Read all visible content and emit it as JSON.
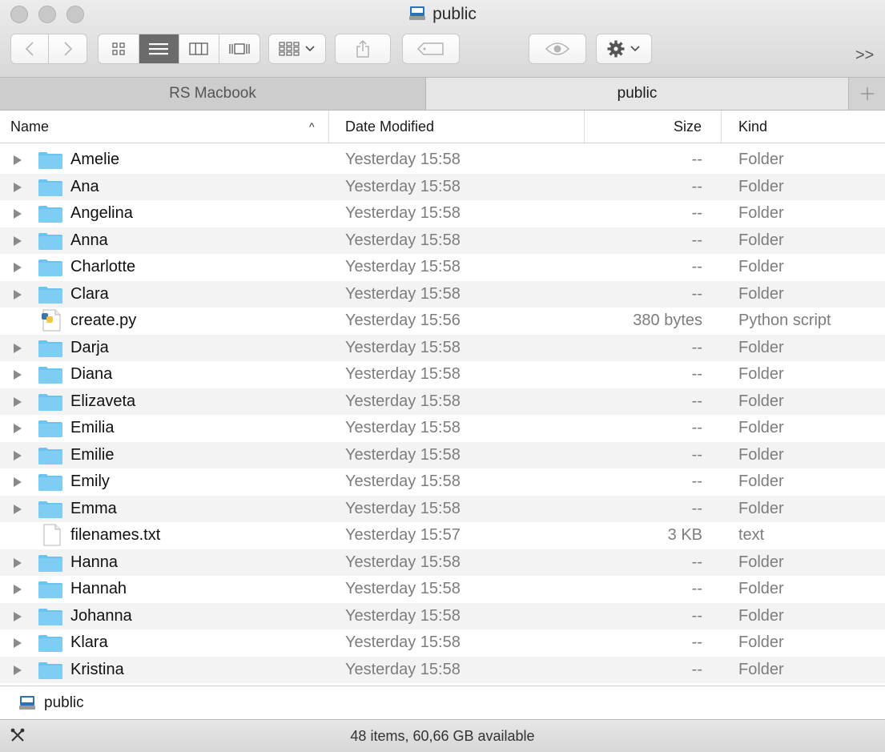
{
  "window": {
    "title": "public"
  },
  "toolbar": {
    "overflow_label": ">>"
  },
  "tabs": [
    {
      "label": "RS Macbook",
      "active": false
    },
    {
      "label": "public",
      "active": true
    }
  ],
  "columns": {
    "name": "Name",
    "date": "Date Modified",
    "size": "Size",
    "kind": "Kind",
    "sort_indicator": "^"
  },
  "rows": [
    {
      "name": "Amelie",
      "date": "Yesterday 15:58",
      "size": "--",
      "kind": "Folder",
      "type": "folder"
    },
    {
      "name": "Ana",
      "date": "Yesterday 15:58",
      "size": "--",
      "kind": "Folder",
      "type": "folder"
    },
    {
      "name": "Angelina",
      "date": "Yesterday 15:58",
      "size": "--",
      "kind": "Folder",
      "type": "folder"
    },
    {
      "name": "Anna",
      "date": "Yesterday 15:58",
      "size": "--",
      "kind": "Folder",
      "type": "folder"
    },
    {
      "name": "Charlotte",
      "date": "Yesterday 15:58",
      "size": "--",
      "kind": "Folder",
      "type": "folder"
    },
    {
      "name": "Clara",
      "date": "Yesterday 15:58",
      "size": "--",
      "kind": "Folder",
      "type": "folder"
    },
    {
      "name": "create.py",
      "date": "Yesterday 15:56",
      "size": "380 bytes",
      "kind": "Python script",
      "type": "python"
    },
    {
      "name": "Darja",
      "date": "Yesterday 15:58",
      "size": "--",
      "kind": "Folder",
      "type": "folder"
    },
    {
      "name": "Diana",
      "date": "Yesterday 15:58",
      "size": "--",
      "kind": "Folder",
      "type": "folder"
    },
    {
      "name": "Elizaveta",
      "date": "Yesterday 15:58",
      "size": "--",
      "kind": "Folder",
      "type": "folder"
    },
    {
      "name": "Emilia",
      "date": "Yesterday 15:58",
      "size": "--",
      "kind": "Folder",
      "type": "folder"
    },
    {
      "name": "Emilie",
      "date": "Yesterday 15:58",
      "size": "--",
      "kind": "Folder",
      "type": "folder"
    },
    {
      "name": "Emily",
      "date": "Yesterday 15:58",
      "size": "--",
      "kind": "Folder",
      "type": "folder"
    },
    {
      "name": "Emma",
      "date": "Yesterday 15:58",
      "size": "--",
      "kind": "Folder",
      "type": "folder"
    },
    {
      "name": "filenames.txt",
      "date": "Yesterday 15:57",
      "size": "3 KB",
      "kind": "text",
      "type": "text"
    },
    {
      "name": "Hanna",
      "date": "Yesterday 15:58",
      "size": "--",
      "kind": "Folder",
      "type": "folder"
    },
    {
      "name": "Hannah",
      "date": "Yesterday 15:58",
      "size": "--",
      "kind": "Folder",
      "type": "folder"
    },
    {
      "name": "Johanna",
      "date": "Yesterday 15:58",
      "size": "--",
      "kind": "Folder",
      "type": "folder"
    },
    {
      "name": "Klara",
      "date": "Yesterday 15:58",
      "size": "--",
      "kind": "Folder",
      "type": "folder"
    },
    {
      "name": "Kristina",
      "date": "Yesterday 15:58",
      "size": "--",
      "kind": "Folder",
      "type": "folder"
    }
  ],
  "pathbar": {
    "label": "public"
  },
  "status": {
    "text": "48 items, 60,66 GB available"
  },
  "colors": {
    "folder": "#6cc3ee",
    "row_alt": "#f3f3f3",
    "muted_text": "#7d7d7d"
  }
}
